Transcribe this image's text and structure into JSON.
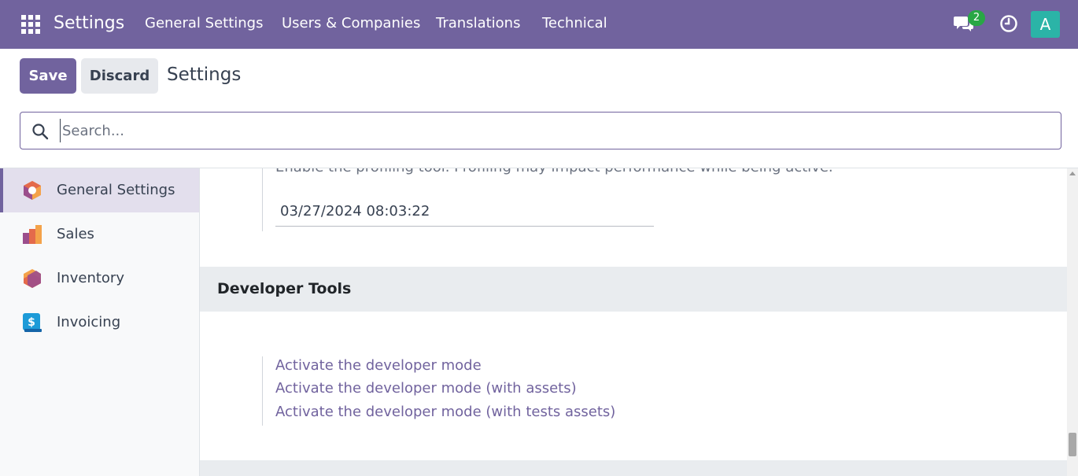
{
  "navbar": {
    "brand": "Settings",
    "menu": [
      "General Settings",
      "Users & Companies",
      "Translations",
      "Technical"
    ],
    "chat_count": "2",
    "avatar_letter": "A",
    "colors": {
      "primary": "#71639e",
      "badge": "#28a745",
      "avatar": "#2bb4a7"
    }
  },
  "control": {
    "save_label": "Save",
    "discard_label": "Discard",
    "title": "Settings"
  },
  "search": {
    "placeholder": "Search..."
  },
  "sidebar": {
    "items": [
      {
        "label": "General Settings",
        "icon": "general-settings-icon",
        "active": true
      },
      {
        "label": "Sales",
        "icon": "sales-icon",
        "active": false
      },
      {
        "label": "Inventory",
        "icon": "inventory-icon",
        "active": false
      },
      {
        "label": "Invoicing",
        "icon": "invoicing-icon",
        "active": false
      }
    ]
  },
  "main": {
    "profiling_text": "Enable the profiling tool. Profiling may impact performance while being active.",
    "profiling_date": "03/27/2024 08:03:22",
    "developer_tools": {
      "title": "Developer Tools",
      "links": [
        "Activate the developer mode",
        "Activate the developer mode (with assets)",
        "Activate the developer mode (with tests assets)"
      ]
    }
  }
}
